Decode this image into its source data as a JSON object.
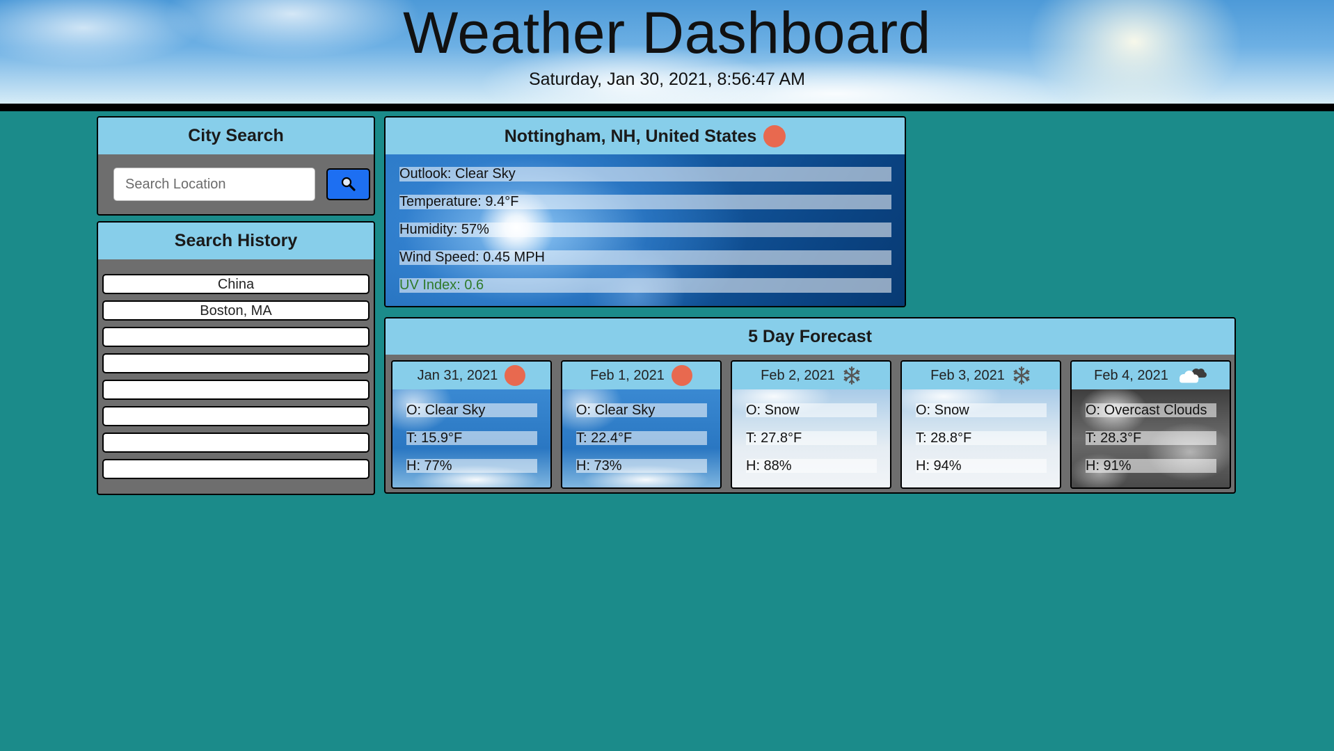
{
  "header": {
    "title": "Weather Dashboard",
    "datetime": "Saturday, Jan 30, 2021, 8:56:47 AM"
  },
  "city_search": {
    "title": "City Search",
    "placeholder": "Search Location",
    "button_icon": "search-icon"
  },
  "search_history": {
    "title": "Search History",
    "items": [
      "China",
      "Boston, MA",
      "",
      "",
      "",
      "",
      "",
      ""
    ]
  },
  "current": {
    "location": "Nottingham, NH, United States",
    "icon": "sun-icon",
    "outlook": "Outlook: Clear Sky",
    "temperature": "Temperature: 9.4°F",
    "humidity": "Humidity: 57%",
    "wind": "Wind Speed: 0.45 MPH",
    "uv": "UV Index: 0.6",
    "uv_color": "#2f7a2a"
  },
  "forecast": {
    "title": "5 Day Forecast",
    "days": [
      {
        "date": "Jan 31, 2021",
        "icon": "sun-icon",
        "outlook": "O: Clear Sky",
        "temp": "T: 15.9°F",
        "humidity": "H: 77%"
      },
      {
        "date": "Feb 1, 2021",
        "icon": "sun-icon",
        "outlook": "O: Clear Sky",
        "temp": "T: 22.4°F",
        "humidity": "H: 73%"
      },
      {
        "date": "Feb 2, 2021",
        "icon": "snowflake-icon",
        "outlook": "O: Snow",
        "temp": "T: 27.8°F",
        "humidity": "H: 88%"
      },
      {
        "date": "Feb 3, 2021",
        "icon": "snowflake-icon",
        "outlook": "O: Snow",
        "temp": "T: 28.8°F",
        "humidity": "H: 94%"
      },
      {
        "date": "Feb 4, 2021",
        "icon": "clouds-icon",
        "outlook": "O: Overcast Clouds",
        "temp": "T: 28.3°F",
        "humidity": "H: 91%"
      }
    ]
  },
  "colors": {
    "background": "#1b8b8a",
    "panel_header": "#87ceea",
    "search_button": "#1d6ff2",
    "sun": "#e8694f"
  }
}
